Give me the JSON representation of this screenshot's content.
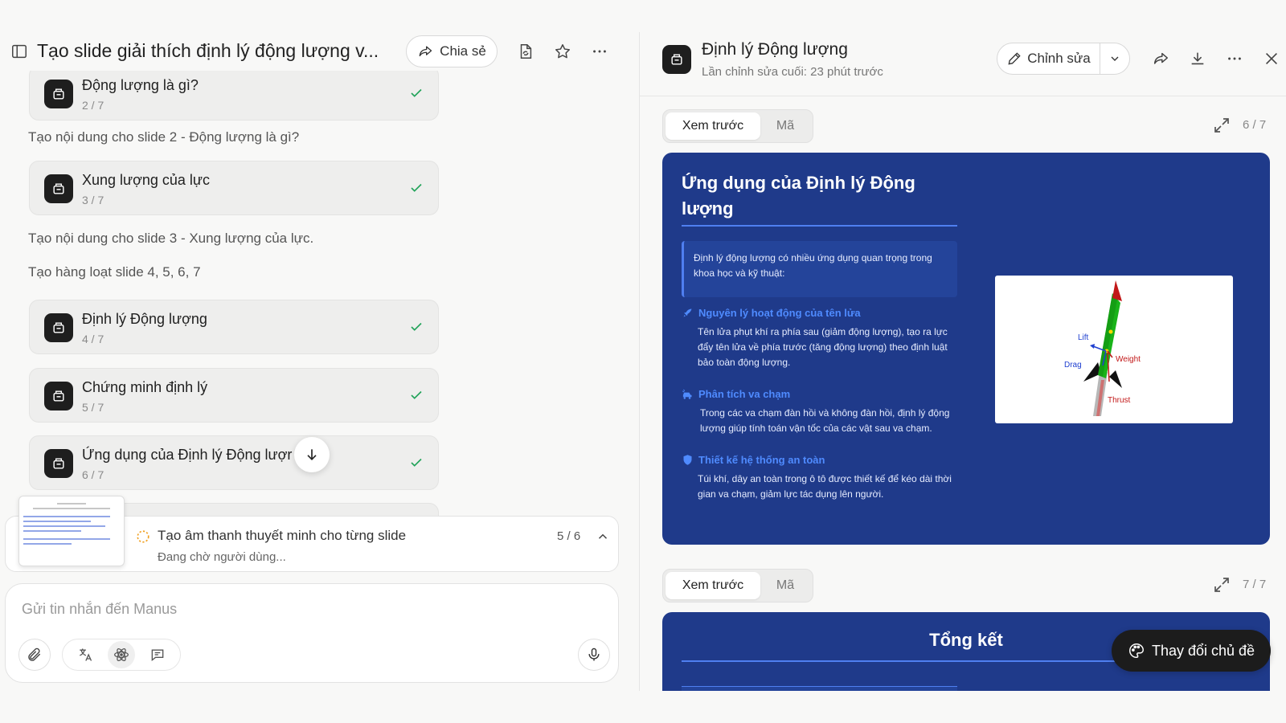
{
  "chat": {
    "title": "Tạo slide giải thích định lý động lượng v...",
    "share_label": "Chia sẻ"
  },
  "cards": [
    {
      "title": "Động lượng là gì?",
      "sub": "2 / 7"
    },
    {
      "title": "Xung lượng của lực",
      "sub": "3 / 7"
    },
    {
      "title": "Định lý Động lượng",
      "sub": "4 / 7"
    },
    {
      "title": "Chứng minh định lý",
      "sub": "5 / 7"
    },
    {
      "title": "Ứng dụng của Định lý Động lượr",
      "sub": "6 / 7"
    }
  ],
  "messages": [
    "Tạo nội dung cho slide 2 - Động lượng là gì?",
    "Tạo nội dung cho slide 3 - Xung lượng của lực.",
    "Tạo hàng loạt slide 4, 5, 6, 7"
  ],
  "task": {
    "title": "Tạo âm thanh thuyết minh cho từng slide",
    "status": "Đang chờ người dùng...",
    "count": "5 / 6"
  },
  "composer": {
    "placeholder": "Gửi tin nhắn đến Manus"
  },
  "viewer": {
    "title": "Định lý Động lượng",
    "subtitle": "Lần chỉnh sửa cuối: 23 phút trước",
    "edit_label": "Chỉnh sửa",
    "tab_preview": "Xem trước",
    "tab_code": "Mã",
    "page_6": "6 / 7",
    "page_7": "7 / 7",
    "theme_label": "Thay đổi chủ đề"
  },
  "slide6": {
    "title": "Ứng dụng của Định lý Động lượng",
    "intro": "Định lý động lượng có nhiều ứng dụng quan trọng trong khoa học và kỹ thuật:",
    "items": [
      {
        "heading": "Nguyên lý hoạt động của tên lửa",
        "text": "Tên lửa phụt khí ra phía sau (giảm động lượng), tạo ra lực đẩy tên lửa về phía trước (tăng động lượng) theo định luật bảo toàn động lượng."
      },
      {
        "heading": "Phân tích va chạm",
        "text": "Trong các va chạm đàn hồi và không đàn hồi, định lý động lượng giúp tính toán vận tốc của các vật sau va chạm."
      },
      {
        "heading": "Thiết kế hệ thống an toàn",
        "text": "Túi khí, dây an toàn trong ô tô được thiết kế để kéo dài thời gian va chạm, giảm lực tác dụng lên người."
      }
    ],
    "figure_labels": {
      "lift": "Lift",
      "drag": "Drag",
      "weight": "Weight",
      "thrust": "Thrust"
    }
  },
  "slide7": {
    "title": "Tổng kết"
  },
  "colors": {
    "slide_bg": "#1f3a8a",
    "slide_accent": "#4f7ff0",
    "check_green": "#22a35a",
    "spinner": "#f0a020"
  }
}
